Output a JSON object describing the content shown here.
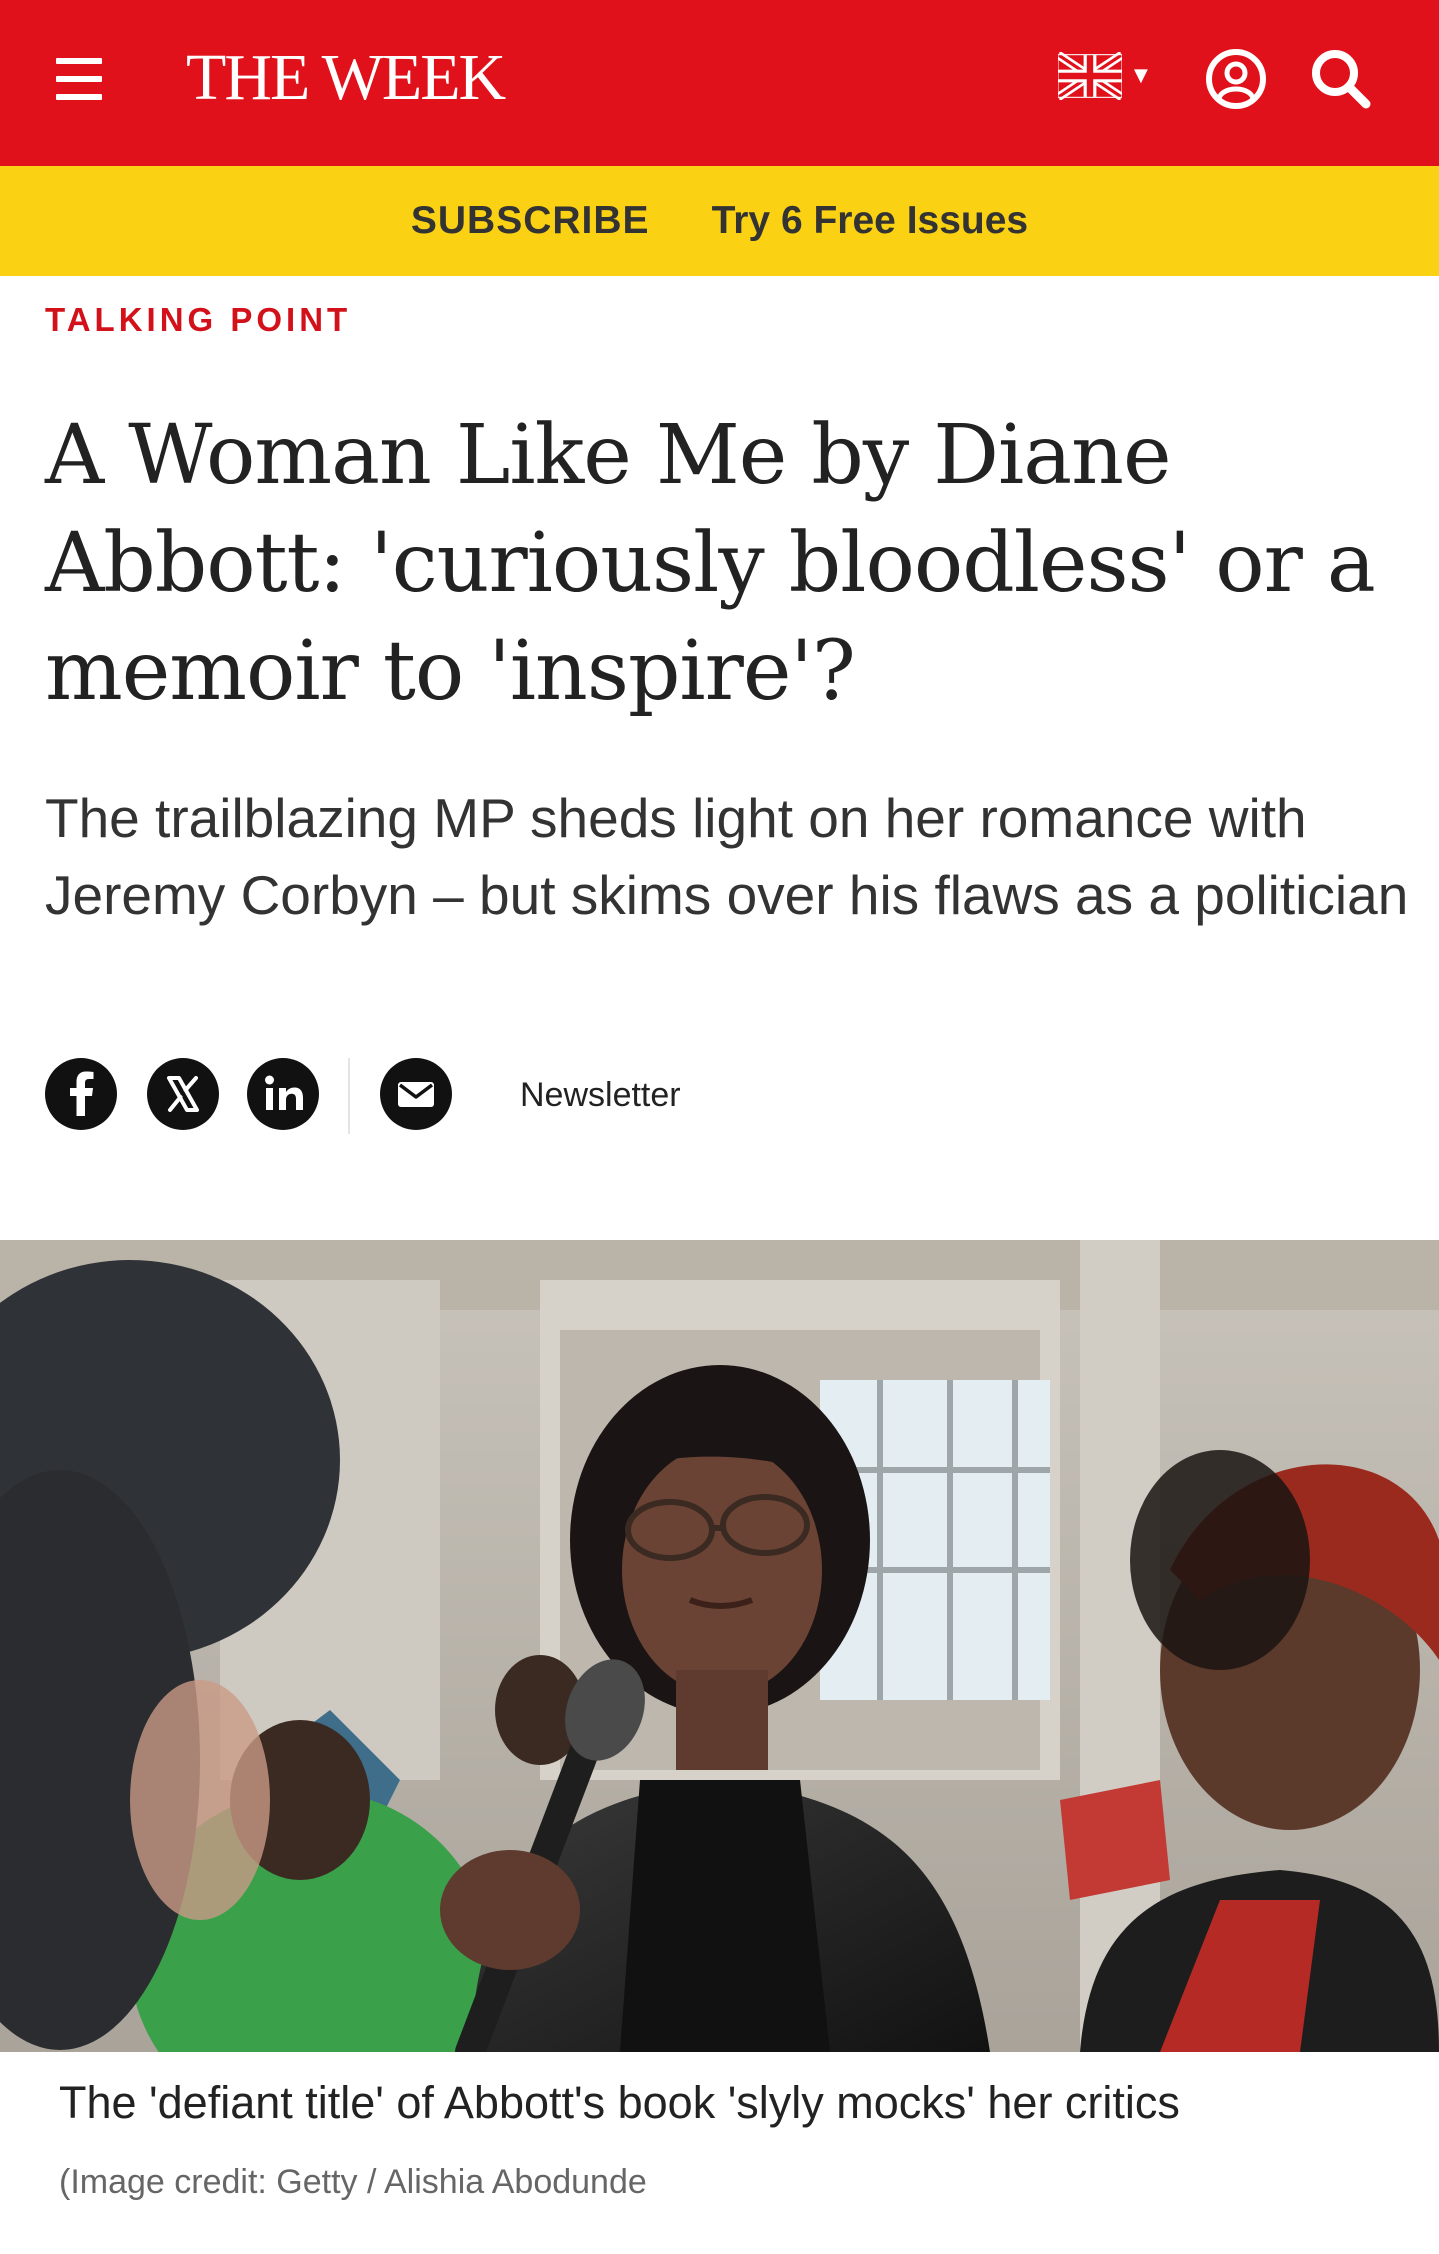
{
  "header": {
    "logo": "THE WEEK",
    "background_color": "#e0111b",
    "menu_icon": "hamburger-menu-icon",
    "region_icon": "uk-flag-icon",
    "account_icon": "user-account-icon",
    "search_icon": "search-icon"
  },
  "subscribe_bar": {
    "background_color": "#fbd113",
    "subscribe_label": "SUBSCRIBE",
    "offer_label": "Try 6 Free Issues"
  },
  "article": {
    "kicker": "TALKING POINT",
    "kicker_color": "#d2111a",
    "headline": "A Woman Like Me by Diane Abbott: 'curiously bloodless' or a memoir to 'inspire'?",
    "standfirst": "The trailblazing MP sheds light on her romance with Jeremy Corbyn – but skims over his flaws as a politician",
    "share": {
      "icons": [
        "facebook-icon",
        "x-icon",
        "linkedin-icon",
        "mail-icon"
      ],
      "newsletter_label": "Newsletter"
    },
    "image": {
      "caption": "The 'defiant title' of Abbott's book 'slyly mocks' her critics",
      "credit": "(Image credit: Getty / Alishia Abodunde"
    }
  }
}
